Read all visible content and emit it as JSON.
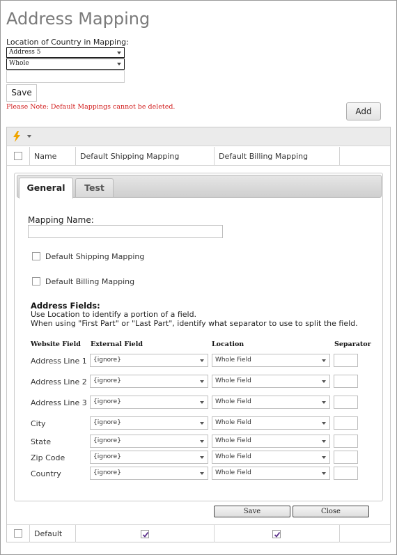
{
  "page": {
    "title": "Address Mapping"
  },
  "country_location": {
    "label": "Location of Country in Mapping:",
    "address_select": "Address 5",
    "portion_select": "Whole",
    "save_label": "Save"
  },
  "note": "Please Note: Default Mappings cannot be deleted.",
  "add_label": "Add",
  "grid": {
    "columns": [
      "Name",
      "Default Shipping Mapping",
      "Default Billing Mapping"
    ],
    "rows": [
      {
        "name": "Default",
        "default_shipping": true,
        "default_billing": true
      }
    ]
  },
  "editor": {
    "tabs": [
      "General",
      "Test"
    ],
    "active_tab": "General",
    "mapping_name_label": "Mapping Name:",
    "mapping_name_value": "",
    "default_shipping_label": "Default Shipping Mapping",
    "default_billing_label": "Default Billing Mapping",
    "address_fields_title": "Address Fields:",
    "address_fields_desc1": "Use Location to identify a portion of a field.",
    "address_fields_desc2": "When using \"First Part\" or \"Last Part\", identify what separator to use to split the field.",
    "col_website_field": "Website Field",
    "col_external_field": "External Field",
    "col_location": "Location",
    "col_separator": "Separator",
    "fields": [
      {
        "website_field": "Address Line 1",
        "external_field": "{ignore}",
        "location": "Whole Field",
        "separator": ""
      },
      {
        "website_field": "Address Line 2",
        "external_field": "{ignore}",
        "location": "Whole Field",
        "separator": ""
      },
      {
        "website_field": "Address Line 3",
        "external_field": "{ignore}",
        "location": "Whole Field",
        "separator": ""
      },
      {
        "website_field": "City",
        "external_field": "{ignore}",
        "location": "Whole Field",
        "separator": ""
      },
      {
        "website_field": "State",
        "external_field": "{ignore}",
        "location": "Whole Field",
        "separator": ""
      },
      {
        "website_field": "Zip Code",
        "external_field": "{ignore}",
        "location": "Whole Field",
        "separator": ""
      },
      {
        "website_field": "Country",
        "external_field": "{ignore}",
        "location": "Whole Field",
        "separator": ""
      }
    ],
    "save_label": "Save",
    "close_label": "Close"
  },
  "icons": {
    "toolbar": "lightning-bolt-icon",
    "toolbar_color": "#f0a500",
    "note_color": "#d21f1f"
  }
}
